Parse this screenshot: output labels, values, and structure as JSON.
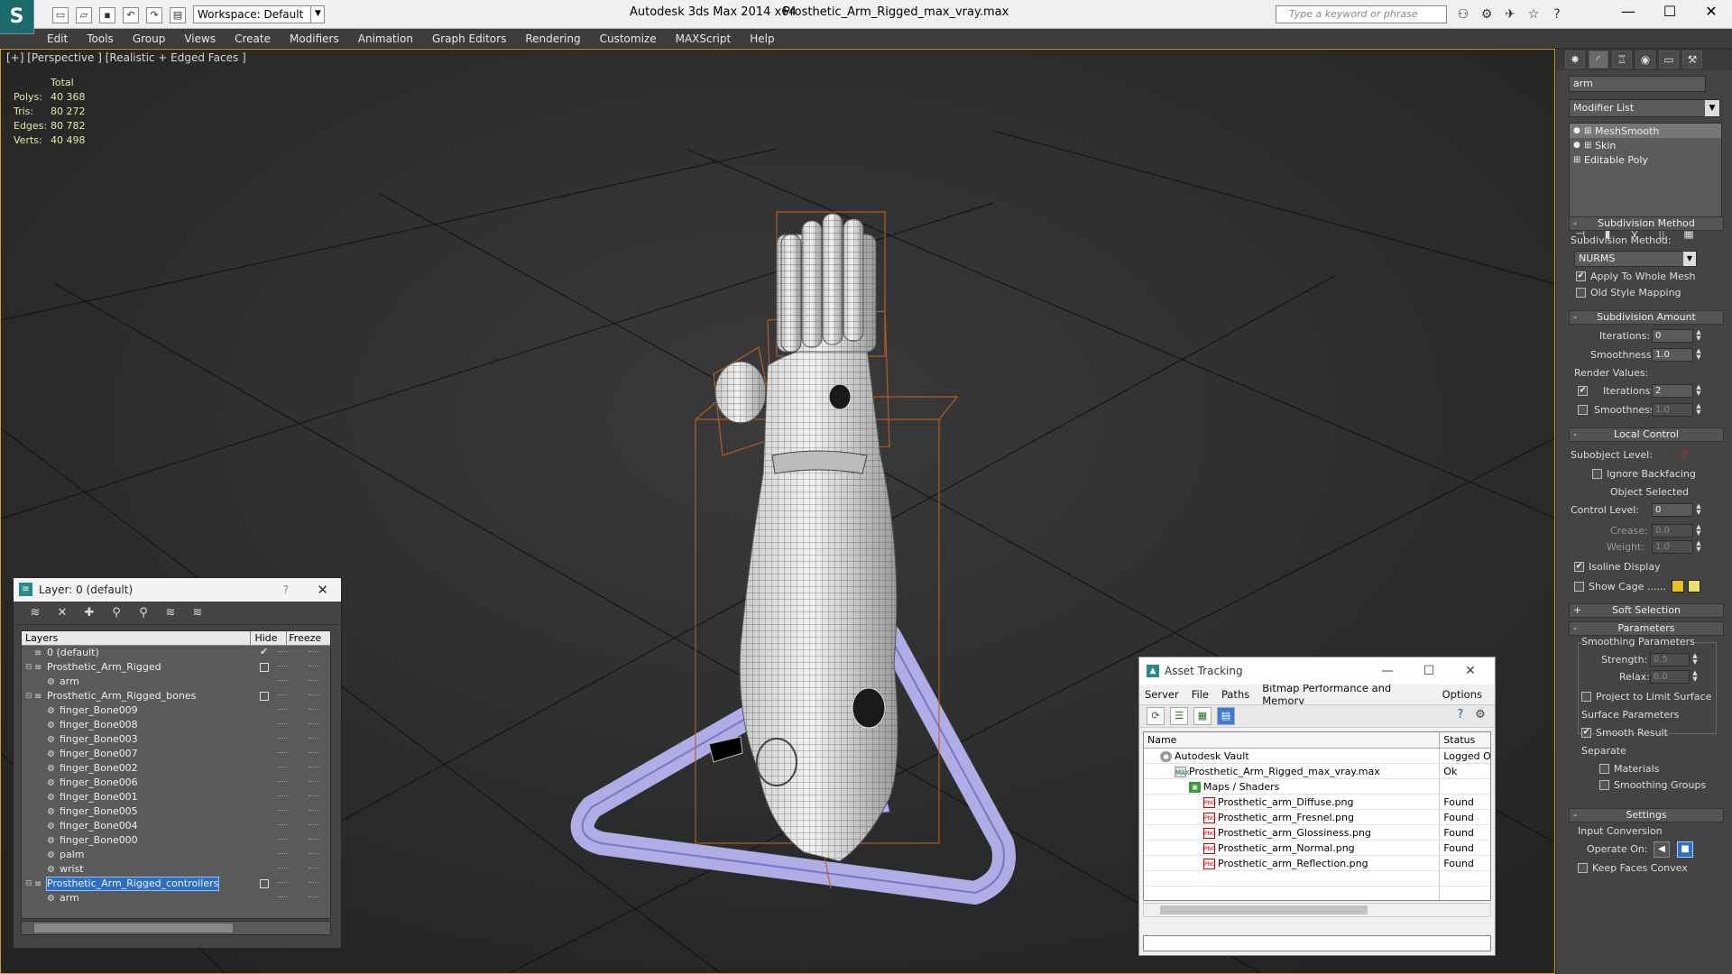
{
  "titlebar": {
    "logo": "S",
    "workspace": "Workspace: Default",
    "app_title": "Autodesk 3ds Max  2014 x64",
    "file_title": "Prosthetic_Arm_Rigged_max_vray.max",
    "search_placeholder": "Type a keyword or phrase",
    "help_icon": "?",
    "min": "—",
    "max": "☐",
    "close": "✕"
  },
  "menu": [
    "Edit",
    "Tools",
    "Group",
    "Views",
    "Create",
    "Modifiers",
    "Animation",
    "Graph Editors",
    "Rendering",
    "Customize",
    "MAXScript",
    "Help"
  ],
  "viewport": {
    "label": "[+] [Perspective ] [Realistic + Edged Faces ]",
    "stats": {
      "header": "Total",
      "rows": [
        {
          "key": "Polys:",
          "val": "40 368"
        },
        {
          "key": "Tris:",
          "val": "80 272"
        },
        {
          "key": "Edges:",
          "val": "80 782"
        },
        {
          "key": "Verts:",
          "val": "40 498"
        }
      ]
    }
  },
  "command_panel": {
    "object_name": "arm",
    "modifier_list": "Modifier List",
    "stack": [
      "MeshSmooth",
      "Skin",
      "Editable Poly"
    ],
    "subdivision_method": {
      "title": "Subdivision Method",
      "method_label": "Subdivision Method:",
      "method_value": "NURMS",
      "apply_whole_mesh": "Apply To Whole Mesh",
      "old_style": "Old Style Mapping"
    },
    "subdivision_amount": {
      "title": "Subdivision Amount",
      "iterations_label": "Iterations:",
      "iterations": "0",
      "smoothness_label": "Smoothness:",
      "smoothness": "1.0",
      "render_values": "Render Values:",
      "render_iterations": "2",
      "render_smoothness": "1.0"
    },
    "local_control": {
      "title": "Local Control",
      "subobject_label": "Subobject Level:",
      "ignore_backfacing": "Ignore Backfacing",
      "object_selected": "Object Selected",
      "control_level_label": "Control Level:",
      "control_level": "0",
      "crease_label": "Crease:",
      "crease": "0.0",
      "weight_label": "Weight:",
      "weight": "1.0",
      "isoline": "Isoline Display",
      "show_cage": "Show Cage ......"
    },
    "soft_selection": "Soft Selection",
    "parameters": {
      "title": "Parameters",
      "smoothing_params": "Smoothing Parameters",
      "strength_label": "Strength:",
      "strength": "0.5",
      "relax_label": "Relax:",
      "relax": "0.0",
      "project_limit": "Project to Limit Surface",
      "surface_params": "Surface Parameters",
      "smooth_result": "Smooth Result",
      "separate": "Separate",
      "materials": "Materials",
      "smoothing_groups": "Smoothing Groups"
    },
    "settings": {
      "title": "Settings",
      "input_conversion": "Input Conversion",
      "operate_on": "Operate On:",
      "keep_faces": "Keep Faces Convex"
    },
    "colors": {
      "cage1": "#e8c020",
      "cage2": "#e8e070"
    }
  },
  "layer_explorer": {
    "title": "Layer: 0 (default)",
    "help": "?",
    "close": "✕",
    "columns": {
      "layers": "Layers",
      "hide": "Hide",
      "freeze": "Freeze"
    },
    "rows": [
      {
        "name": "0 (default)",
        "level": 0,
        "expand": "",
        "current": true
      },
      {
        "name": "Prosthetic_Arm_Rigged",
        "level": 0,
        "expand": "⊟",
        "box": true
      },
      {
        "name": "arm",
        "level": 1
      },
      {
        "name": "Prosthetic_Arm_Rigged_bones",
        "level": 0,
        "expand": "⊟",
        "box": true
      },
      {
        "name": "finger_Bone009",
        "level": 1
      },
      {
        "name": "finger_Bone008",
        "level": 1
      },
      {
        "name": "finger_Bone003",
        "level": 1
      },
      {
        "name": "finger_Bone007",
        "level": 1
      },
      {
        "name": "finger_Bone002",
        "level": 1
      },
      {
        "name": "finger_Bone006",
        "level": 1
      },
      {
        "name": "finger_Bone001",
        "level": 1
      },
      {
        "name": "finger_Bone005",
        "level": 1
      },
      {
        "name": "finger_Bone004",
        "level": 1
      },
      {
        "name": "finger_Bone000",
        "level": 1
      },
      {
        "name": "palm",
        "level": 1
      },
      {
        "name": "wrist",
        "level": 1
      },
      {
        "name": "Prosthetic_Arm_Rigged_controllers",
        "level": 0,
        "expand": "⊟",
        "box": true,
        "selected": true
      },
      {
        "name": "arm",
        "level": 1
      }
    ]
  },
  "asset_tracking": {
    "title": "Asset Tracking",
    "menu": [
      "Server",
      "File",
      "Paths",
      "Bitmap Performance and Memory",
      "Options"
    ],
    "columns": {
      "name": "Name",
      "status": "Status"
    },
    "rows": [
      {
        "name": "Autodesk Vault",
        "status": "Logged O",
        "icon": "vault",
        "indent": 0
      },
      {
        "name": "Prosthetic_Arm_Rigged_max_vray.max",
        "status": "Ok",
        "icon": "max",
        "indent": 1
      },
      {
        "name": "Maps / Shaders",
        "status": "",
        "icon": "maps",
        "indent": 2
      },
      {
        "name": "Prosthetic_arm_Diffuse.png",
        "status": "Found",
        "icon": "png",
        "indent": 3
      },
      {
        "name": "Prosthetic_arm_Fresnel.png",
        "status": "Found",
        "icon": "png",
        "indent": 3
      },
      {
        "name": "Prosthetic_arm_Glossiness.png",
        "status": "Found",
        "icon": "png",
        "indent": 3
      },
      {
        "name": "Prosthetic_arm_Normal.png",
        "status": "Found",
        "icon": "png",
        "indent": 3
      },
      {
        "name": "Prosthetic_arm_Reflection.png",
        "status": "Found",
        "icon": "png",
        "indent": 3
      }
    ]
  }
}
